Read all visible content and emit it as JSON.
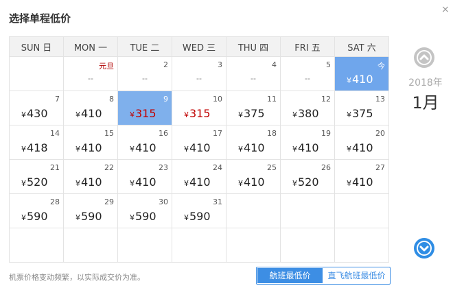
{
  "title": "选择单程低价",
  "close_label": "×",
  "weekdays": [
    "SUN 日",
    "MON 一",
    "TUE 二",
    "WED 三",
    "THU 四",
    "FRI 五",
    "SAT 六"
  ],
  "currency": "¥",
  "weeks": [
    [
      {
        "day": "",
        "price": ""
      },
      {
        "day": "元旦",
        "price": "--",
        "holiday": true
      },
      {
        "day": "2",
        "price": "--"
      },
      {
        "day": "3",
        "price": "--"
      },
      {
        "day": "4",
        "price": "--"
      },
      {
        "day": "5",
        "price": "--"
      },
      {
        "day": "今",
        "price": "410",
        "today": true
      }
    ],
    [
      {
        "day": "7",
        "price": "430"
      },
      {
        "day": "8",
        "price": "410"
      },
      {
        "day": "9",
        "price": "315",
        "low": true,
        "selected": true
      },
      {
        "day": "10",
        "price": "315",
        "low": true
      },
      {
        "day": "11",
        "price": "375"
      },
      {
        "day": "12",
        "price": "380"
      },
      {
        "day": "13",
        "price": "375"
      }
    ],
    [
      {
        "day": "14",
        "price": "418"
      },
      {
        "day": "15",
        "price": "410"
      },
      {
        "day": "16",
        "price": "410"
      },
      {
        "day": "17",
        "price": "410"
      },
      {
        "day": "18",
        "price": "410"
      },
      {
        "day": "19",
        "price": "410"
      },
      {
        "day": "20",
        "price": "410"
      }
    ],
    [
      {
        "day": "21",
        "price": "520"
      },
      {
        "day": "22",
        "price": "410"
      },
      {
        "day": "23",
        "price": "410"
      },
      {
        "day": "24",
        "price": "410"
      },
      {
        "day": "25",
        "price": "410"
      },
      {
        "day": "26",
        "price": "520"
      },
      {
        "day": "27",
        "price": "410"
      }
    ],
    [
      {
        "day": "28",
        "price": "590"
      },
      {
        "day": "29",
        "price": "590"
      },
      {
        "day": "30",
        "price": "590"
      },
      {
        "day": "31",
        "price": "590"
      },
      {
        "day": "",
        "price": ""
      },
      {
        "day": "",
        "price": ""
      },
      {
        "day": "",
        "price": ""
      }
    ],
    [
      {
        "day": "",
        "price": ""
      },
      {
        "day": "",
        "price": ""
      },
      {
        "day": "",
        "price": ""
      },
      {
        "day": "",
        "price": ""
      },
      {
        "day": "",
        "price": ""
      },
      {
        "day": "",
        "price": ""
      },
      {
        "day": "",
        "price": ""
      }
    ]
  ],
  "sidebar": {
    "year": "2018年",
    "month": "1月",
    "prev_icon": "chevron-up-icon",
    "next_icon": "chevron-down-icon"
  },
  "footer": {
    "note": "机票价格变动频繁，以实际成交价为准。",
    "tab_flight_low": "航班最低价",
    "tab_direct_low": "直飞航班最低价"
  },
  "colors": {
    "selected_bg": "#7fb0ec",
    "today_bg": "#6fa6ec",
    "low_price": "#c00000",
    "accent": "#3d8ee4"
  }
}
